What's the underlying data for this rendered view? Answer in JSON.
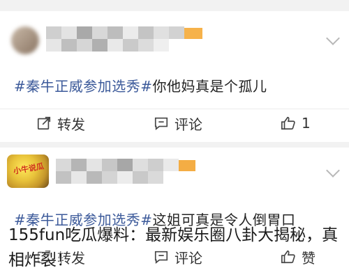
{
  "posts": [
    {
      "hashtag": "#秦牛正威参加选秀#",
      "text": "你他妈真是个孤儿",
      "actions": {
        "forward": "转发",
        "comment": "评论",
        "like": "1"
      }
    },
    {
      "avatar_text": "小牛说瓜",
      "hashtag": "#秦牛正威参加选秀#",
      "text": "这姐可真是令人倒胃口",
      "actions": {
        "forward": "转发",
        "comment": "评论",
        "like": "赞"
      }
    }
  ],
  "overlay_caption": "155fun吃瓜爆料：最新娱乐圈八卦大揭秘，真相炸裂！",
  "icons": [
    "forward-icon",
    "comment-icon",
    "like-icon",
    "chevron-down-icon"
  ],
  "colors": {
    "hashtag": "#3c5a9a",
    "background": "#f2f2f2",
    "card": "#ffffff"
  }
}
